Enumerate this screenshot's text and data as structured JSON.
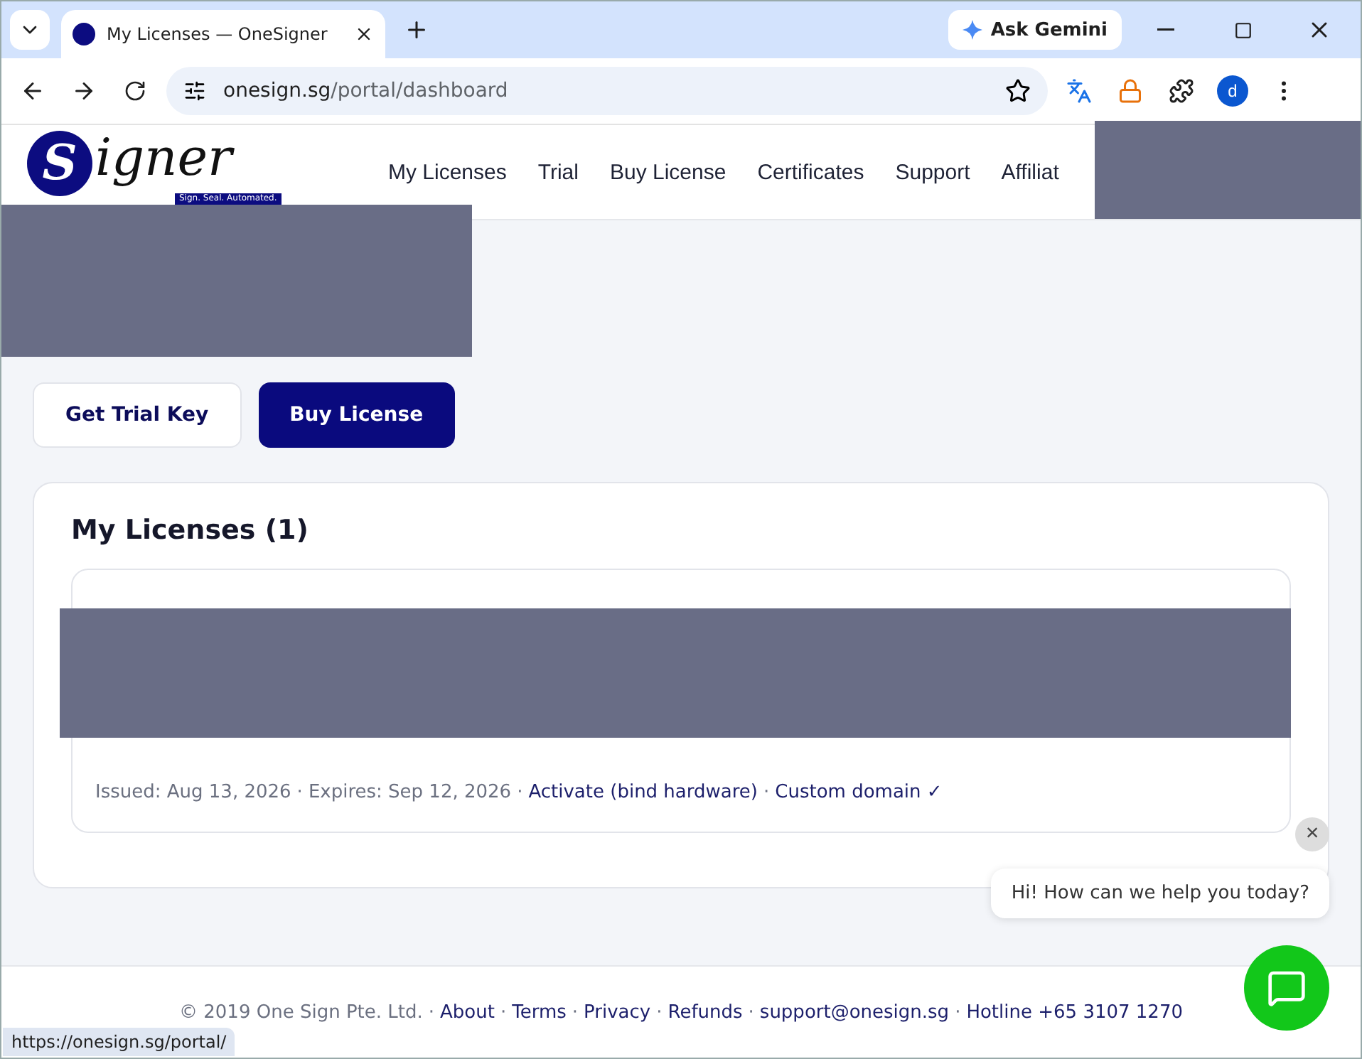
{
  "browser": {
    "tab_title": "My Licenses — OneSigner",
    "gemini": "Ask Gemini",
    "url_host": "onesign.sg",
    "url_path": "/portal/dashboard",
    "profile": "d",
    "status_url": "https://onesign.sg/portal/"
  },
  "logo": {
    "mark": "S",
    "word": "igner",
    "tagline": "Sign. Seal. Automated."
  },
  "nav": [
    {
      "label": "My Licenses"
    },
    {
      "label": "Trial"
    },
    {
      "label": "Buy License"
    },
    {
      "label": "Certificates"
    },
    {
      "label": "Support"
    },
    {
      "label": "Affiliat"
    }
  ],
  "actions": [
    {
      "label": "Get Trial Key",
      "kind": "secondary"
    },
    {
      "label": "Buy License",
      "kind": "primary"
    }
  ],
  "licenses": {
    "title": "My Licenses (1)",
    "items": [
      {
        "issued": "Issued: Aug 13, 2026",
        "expires": "Expires: Sep 12, 2026",
        "links": [
          "Activate (bind hardware)",
          "Custom domain ✓"
        ]
      }
    ]
  },
  "chat": {
    "close": "×",
    "message": "Hi! How can we help you today?"
  },
  "separator": "·",
  "footer": {
    "copyright": "© 2019 One Sign Pte. Ltd.",
    "links": [
      "About",
      "Terms",
      "Privacy",
      "Refunds",
      "support@onesign.sg",
      "Hotline +65 3107 1270"
    ]
  }
}
